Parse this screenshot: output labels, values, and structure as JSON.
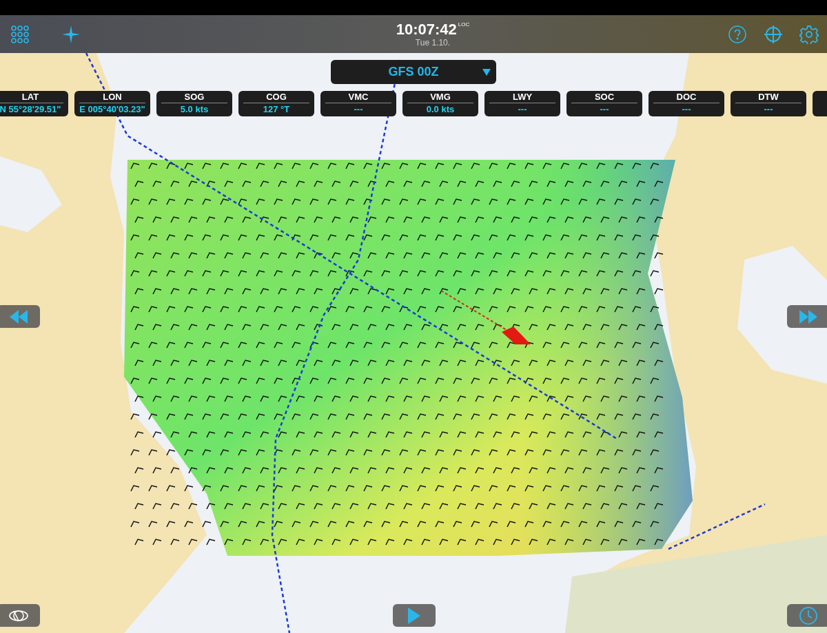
{
  "toolbar": {
    "time": "10:07:42",
    "time_zone": "LOC",
    "date": "Tue 1.10."
  },
  "model_selector": {
    "label": "GFS 00Z"
  },
  "instruments": [
    {
      "label": "LAT",
      "value": "N  55°28'29.51\""
    },
    {
      "label": "LON",
      "value": "E 005°40'03.23\""
    },
    {
      "label": "SOG",
      "value": "5.0 kts"
    },
    {
      "label": "COG",
      "value": "127 °T"
    },
    {
      "label": "VMC",
      "value": "---"
    },
    {
      "label": "VMG",
      "value": "0.0 kts"
    },
    {
      "label": "LWY",
      "value": "---"
    },
    {
      "label": "SOC",
      "value": "---"
    },
    {
      "label": "DOC",
      "value": "---"
    },
    {
      "label": "DTW",
      "value": "---"
    }
  ]
}
